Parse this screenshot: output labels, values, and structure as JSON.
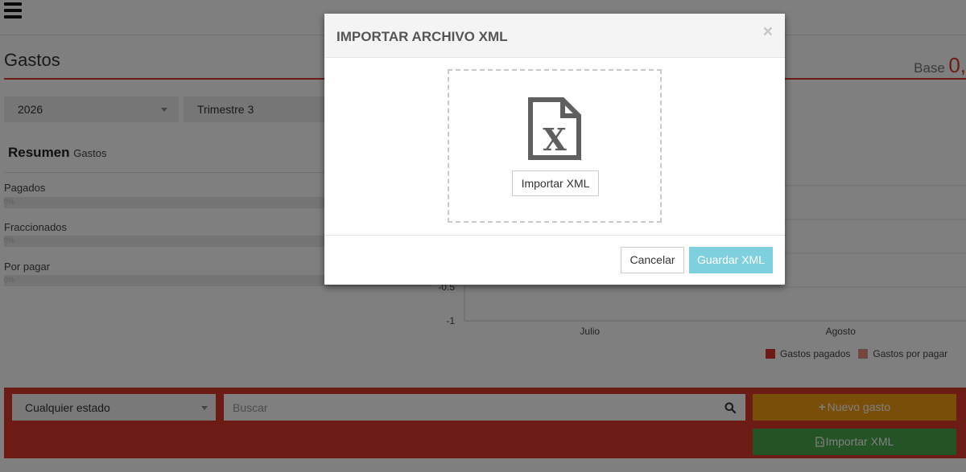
{
  "header": {
    "menu_icon": "hamburger-menu-icon"
  },
  "page": {
    "title": "Gastos",
    "base_label": "Base",
    "base_value": "0,"
  },
  "filters": {
    "year": "2026",
    "quarter": "Trimestre 3"
  },
  "summary": {
    "title": "Resumen",
    "subtitle": "Gastos",
    "stats": [
      {
        "label": "Pagados",
        "percent_text": "0%",
        "value_fraction": 0
      },
      {
        "label": "Fraccionados",
        "percent_text": "0%",
        "value_fraction": 0
      },
      {
        "label": "Por pagar",
        "percent_text": "0%",
        "value_fraction": 0
      }
    ]
  },
  "chart_data": {
    "type": "bar",
    "categories": [
      "Julio",
      "Agosto"
    ],
    "series": [
      {
        "name": "Gastos pagados",
        "values": [
          0,
          0
        ],
        "color": "#d9362b"
      },
      {
        "name": "Gastos por pagar",
        "values": [
          0,
          0
        ],
        "color": "#e88c85"
      }
    ],
    "ytick_labels": [
      "-0.5",
      "-1"
    ],
    "ylim": [
      -1,
      1
    ],
    "legend": "bottom-right",
    "grid": true
  },
  "bottom_bar": {
    "state_select": "Cualquier estado",
    "search_placeholder": "Buscar",
    "search_icon": "search-icon",
    "new_button": "Nuevo gasto",
    "new_button_icon": "plus-icon",
    "import_button": "Importar XML",
    "import_button_icon": "file-code-icon",
    "panel_color": "#d9362b"
  },
  "modal": {
    "title": "IMPORTAR ARCHIVO XML",
    "close_symbol": "×",
    "file_icon": "xml-file-icon",
    "file_icon_letter": "X",
    "import_button": "Importar XML",
    "cancel_button": "Cancelar",
    "save_button": "Guardar XML",
    "save_button_color": "#7fd0df"
  }
}
